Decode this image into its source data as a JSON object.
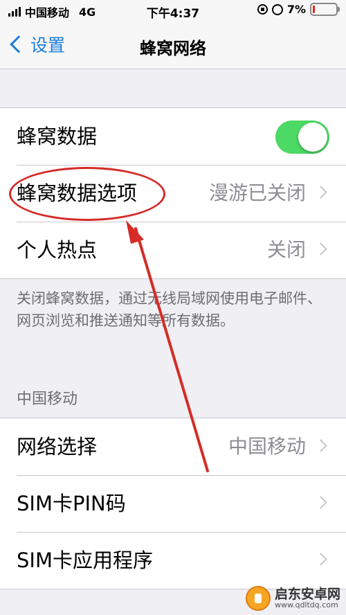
{
  "status_bar": {
    "carrier": "中国移动",
    "network": "4G",
    "time": "下午4:37",
    "battery": "7%"
  },
  "nav": {
    "back_label": "设置",
    "title": "蜂窝网络"
  },
  "group1": {
    "cellular_data_label": "蜂窝数据",
    "cellular_data_on": true,
    "options_label": "蜂窝数据选项",
    "options_value": "漫游已关闭",
    "hotspot_label": "个人热点",
    "hotspot_value": "关闭"
  },
  "footer_note": "关闭蜂窝数据，通过无线局域网使用电子邮件、网页浏览和推送通知等所有数据。",
  "section2": {
    "header": "中国移动",
    "network_select_label": "网络选择",
    "network_select_value": "中国移动",
    "sim_pin_label": "SIM卡PIN码",
    "sim_apps_label": "SIM卡应用程序"
  },
  "watermark": {
    "name": "启东安卓网",
    "url": "www.qdltdq.com"
  },
  "colors": {
    "accent": "#1a7dd9",
    "toggle_on": "#4cd964",
    "annotation": "#d62b26",
    "battery_low": "#e0231b"
  }
}
